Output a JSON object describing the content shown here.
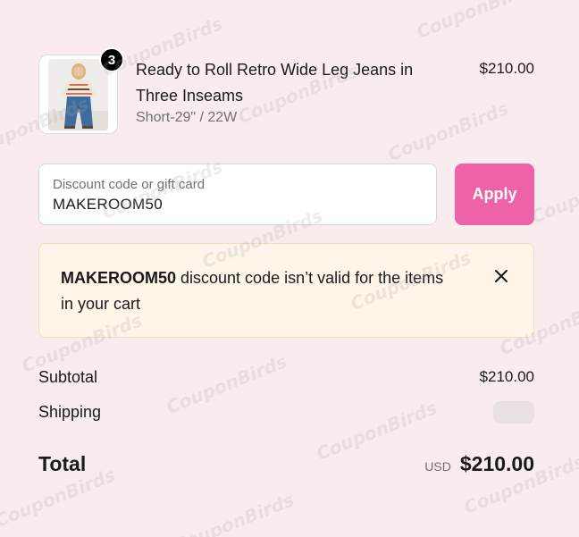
{
  "line_item": {
    "quantity": "3",
    "title": "Ready to Roll Retro Wide Leg Jeans in Three Inseams",
    "variant": "Short-29\" / 22W",
    "price": "$210.00"
  },
  "discount": {
    "label": "Discount code or gift card",
    "value": "MAKEROOM50",
    "apply_label": "Apply",
    "apply_color": "#ee62a7"
  },
  "error": {
    "code": "MAKEROOM50",
    "message": " discount code isn’t valid for the items in your cart",
    "close_icon": "close-icon"
  },
  "summary": {
    "subtotal_label": "Subtotal",
    "subtotal_value": "$210.00",
    "shipping_label": "Shipping",
    "total_label": "Total",
    "currency": "USD",
    "total_value": "$210.00"
  },
  "watermark": "CouponBirds"
}
